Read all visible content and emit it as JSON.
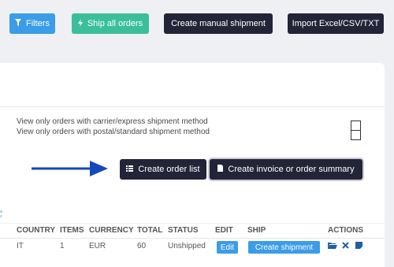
{
  "toolbar": {
    "filters_label": "Filters",
    "ship_all_label": "Ship all orders",
    "manual_label": "Create manual shipment",
    "import_label": "Import Excel/CSV/TXT"
  },
  "filters": {
    "carrier_text": "View only orders with carrier/express shipment method",
    "postal_text": "View only orders with postal/standard shipment method"
  },
  "actions": {
    "order_list_label": "Create order list",
    "invoice_label": "Create invoice or order summary"
  },
  "table": {
    "headers": [
      "COUNTRY",
      "ITEMS",
      "CURRENCY",
      "TOTAL",
      "STATUS",
      "EDIT",
      "SHIP",
      "ACTIONS"
    ],
    "row": {
      "country": "IT",
      "items": "1",
      "currency": "EUR",
      "total": "60",
      "status": "Unshipped",
      "edit_label": "Edit",
      "ship_label": "Create shipment"
    }
  },
  "colors": {
    "primary": "#3b9ce8",
    "success": "#3bbf9b",
    "dark": "#232438",
    "arrow": "#1548b8"
  },
  "icons": [
    "filter-icon",
    "bolt-icon",
    "list-icon",
    "file-icon",
    "sort-icon",
    "folder-open-icon",
    "delete-icon",
    "note-icon",
    "arrow-right-icon"
  ]
}
